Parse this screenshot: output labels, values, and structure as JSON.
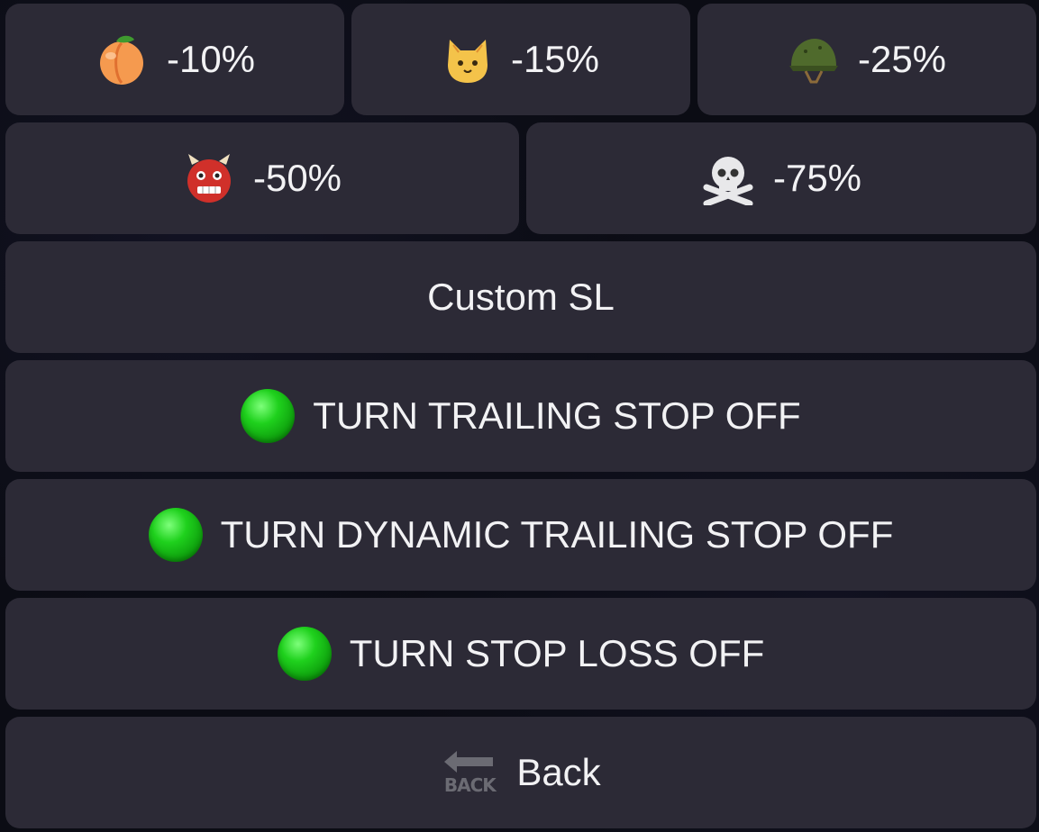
{
  "rows": [
    [
      {
        "icon": "peach-icon",
        "label": "-10%"
      },
      {
        "icon": "cat-face-icon",
        "label": "-15%"
      },
      {
        "icon": "military-helmet-icon",
        "label": "-25%"
      }
    ],
    [
      {
        "icon": "ogre-icon",
        "label": "-50%"
      },
      {
        "icon": "skull-and-crossbones-icon",
        "label": "-75%"
      }
    ]
  ],
  "custom_sl": {
    "label": "Custom SL"
  },
  "trailing_stop": {
    "icon": "green-circle-icon",
    "label": "TURN TRAILING STOP OFF"
  },
  "dynamic_trailing_stop": {
    "icon": "green-circle-icon",
    "label": "TURN DYNAMIC TRAILING STOP OFF"
  },
  "stop_loss": {
    "icon": "green-circle-icon",
    "label": "TURN STOP LOSS OFF"
  },
  "back": {
    "icon": "back-arrow-icon",
    "icon_text": "BACK",
    "label": "Back"
  },
  "colors": {
    "button_bg": "#2c2a36",
    "background": "#0b0c14",
    "text": "#f2f2f4",
    "status_on": "#1fd11d"
  }
}
